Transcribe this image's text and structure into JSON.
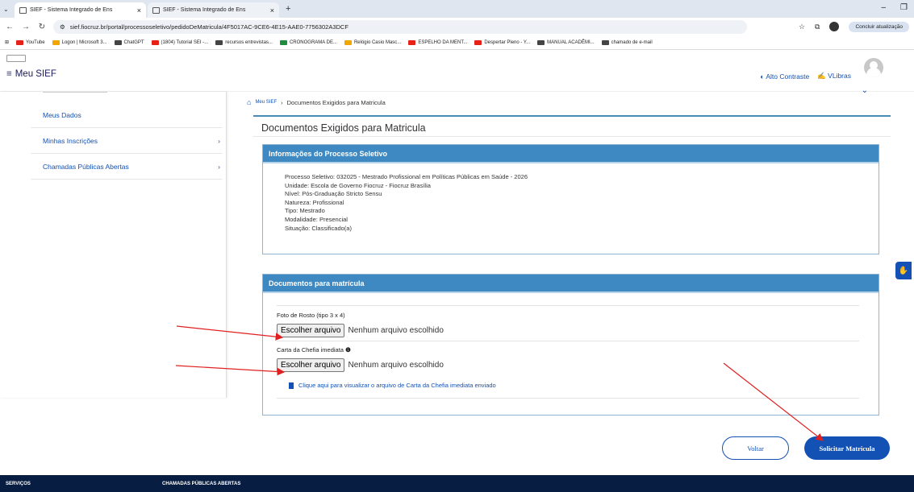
{
  "browser": {
    "tabs": [
      {
        "title": "SIEF - Sistema Integrado de Ens",
        "active": true
      },
      {
        "title": "SIEF - Sistema Integrado de Ens",
        "active": false
      }
    ],
    "url": "sief.fiocruz.br/portal/processoseletivo/pedidoDeMatricula/4F5017AC-9CE6-4E15-AAE0-7756302A3DCF",
    "profile_initial": "P",
    "update_label": "Concluir atualização",
    "bookmarks": [
      {
        "label": "YouTube",
        "color": "#e62117"
      },
      {
        "label": "Logon | Microsoft 3...",
        "color": "#f2a600"
      },
      {
        "label": "ChatGPT",
        "color": "#444444"
      },
      {
        "label": "(1804) Tutorial SEI -...",
        "color": "#e62117"
      },
      {
        "label": "recursos entrevistas...",
        "color": "#444444"
      },
      {
        "label": "CRONOGRAMA DE...",
        "color": "#1e8e3e"
      },
      {
        "label": "Relógio Casio Masc...",
        "color": "#f2a600"
      },
      {
        "label": "ESPELHO DA MENT...",
        "color": "#e62117"
      },
      {
        "label": "Despertar Pleno - Y...",
        "color": "#e62117"
      },
      {
        "label": "MANUAL ACADÊMI...",
        "color": "#444444"
      },
      {
        "label": "chamado de e-mail",
        "color": "#444444"
      }
    ]
  },
  "header": {
    "menu_title": "Meu SIEF",
    "alto_contraste": "Alto Contraste",
    "vlibras": "VLibras"
  },
  "sidebar": {
    "items": [
      {
        "label": "Meus Dados",
        "chevron": ""
      },
      {
        "label": "Minhas Inscrições",
        "chevron": "›"
      },
      {
        "label": "Chamadas Públicas Abertas",
        "chevron": "›"
      }
    ]
  },
  "breadcrumb": {
    "home": "Meu SIEF",
    "current": "Documentos Exigidos para Matricula"
  },
  "page_title": "Documentos Exigidos para Matricula",
  "info_panel": {
    "title": "Informações do Processo Seletivo",
    "lines": [
      "Processo Seletivo: 032025 - Mestrado Profissional em Políticas Públicas em Saúde - 2026",
      "Unidade: Escola de Governo Fiocruz - Fiocruz Brasília",
      "Nível: Pós-Graduação Stricto Sensu",
      "Natureza: Profissional",
      "Tipo: Mestrado",
      "Modalidade: Presencial",
      "Situação: Classificado(a)"
    ]
  },
  "docs_panel": {
    "title": "Documentos para matrícula",
    "fields": [
      {
        "label": "Foto de Rosto (tipo 3 x 4)",
        "button": "Escolher arquivo",
        "status": "Nenhum arquivo escolhido"
      },
      {
        "label": "Carta da Chefia imediata",
        "button": "Escolher arquivo",
        "status": "Nenhum arquivo escolhido"
      }
    ],
    "view_link": "Clique aqui para visualizar o arquivo de Carta da Chefia imediata enviado"
  },
  "actions": {
    "back": "Voltar",
    "submit": "Solicitar Matricula"
  },
  "footer": {
    "servicos": "SERVIÇOS",
    "chamadas": "CHAMADAS PÚBLICAS ABERTAS"
  },
  "colors": {
    "primary": "#1351b4",
    "panel_head": "#3e89c2",
    "footer": "#071d41",
    "annotation_arrow": "#e02020"
  }
}
